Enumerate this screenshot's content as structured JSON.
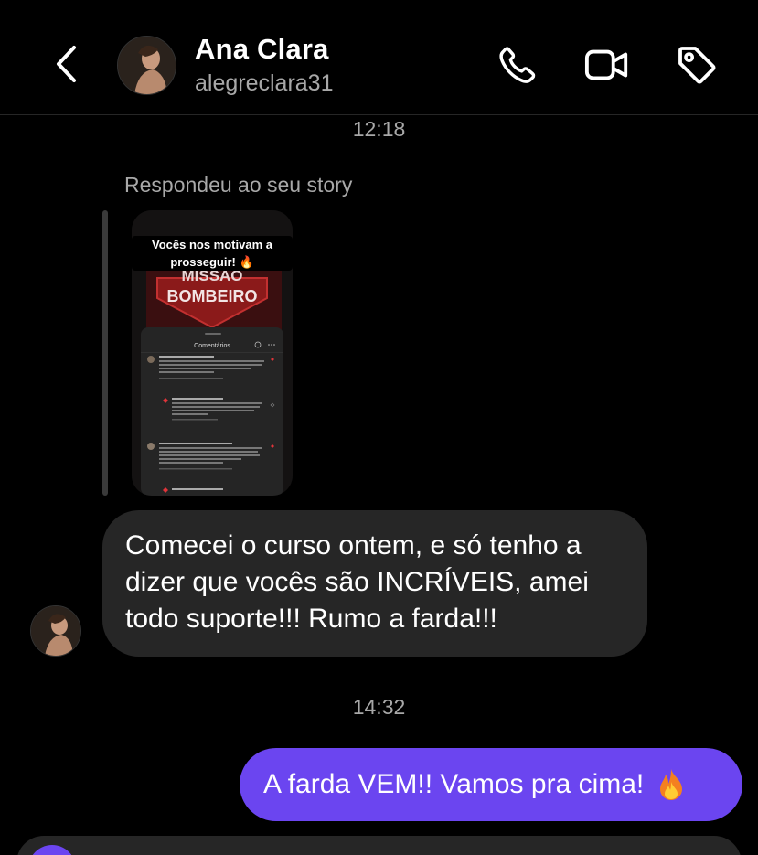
{
  "header": {
    "name": "Ana Clara",
    "handle": "alegreclara31",
    "icons": [
      "back-chevron-icon",
      "phone-icon",
      "video-camera-icon",
      "tag-icon"
    ]
  },
  "conversation": {
    "timestamp_1": "12:18",
    "story_reply_caption": "Respondeu ao seu story",
    "story_preview": {
      "overlay_text": "Vocês nos motivam a prosseguir! 🔥",
      "logo_text": "MISSÃO BOMBEIRO",
      "panel_title": "Comentários"
    },
    "incoming_message": "Comecei o curso ontem, e só tenho a dizer que vocês são INCRÍVEIS, amei todo suporte!!! Rumo a farda!!!",
    "timestamp_2": "14:32",
    "outgoing_message": "A farda VEM!! Vamos pra cima!",
    "outgoing_emoji": "fire-emoji"
  },
  "colors": {
    "background": "#000000",
    "incoming_bubble": "#262626",
    "outgoing_bubble": "#6b45f0",
    "secondary_text": "#a8a8a8"
  }
}
